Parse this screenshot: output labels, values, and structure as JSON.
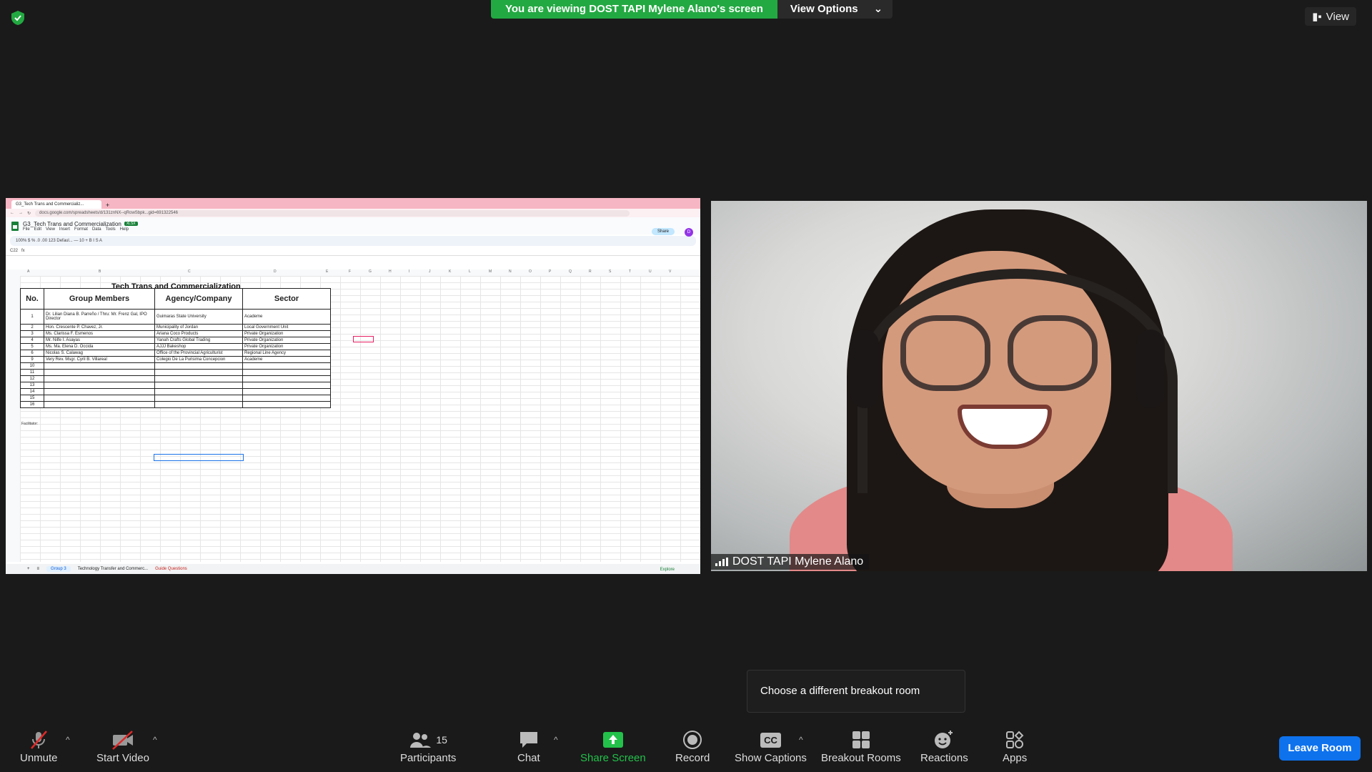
{
  "banner": {
    "viewing_text": "You are viewing DOST TAPI Mylene Alano's screen",
    "view_options": "View Options"
  },
  "top_right": {
    "view_label": "View"
  },
  "shared_screen": {
    "browser_tab": "G3_Tech Trans and Commercializ...",
    "url": "docs.google.com/spreadsheets/d/131znNX--qRowSbpk...gid=691322546",
    "doc_title": "G3_Tech Trans and Commercialization",
    "doc_badge": "XLSX",
    "menu": [
      "File",
      "Edit",
      "View",
      "Insert",
      "Format",
      "Data",
      "Tools",
      "Help"
    ],
    "share_label": "Share",
    "avatar_letter": "D",
    "toolbar_text": "100%  $  %  .0  .00  123  Defaul...  —  10  +  B  I  S  A",
    "name_box": "C22",
    "sheet_title": "Tech Trans and Commercialization",
    "columns": [
      "A",
      "B",
      "C",
      "D",
      "E",
      "F",
      "G",
      "H",
      "I",
      "J",
      "K",
      "L",
      "M",
      "N",
      "O",
      "P",
      "Q",
      "R",
      "S",
      "T",
      "U",
      "V"
    ],
    "table_headers": [
      "No.",
      "Group Members",
      "Agency/Company",
      "Sector"
    ],
    "rows": [
      [
        "1",
        "Dr. Lilian Diana B. Parreño / Thru: Mr. Frenz Gal, IPO Director",
        "Guimaras State University",
        "Academe"
      ],
      [
        "2",
        "Hon. Crescente P. Chavez, Jr.",
        "Municipality of Jordan",
        "Local Government Unit"
      ],
      [
        "3",
        "Ms. Clarissa F. Esmenos",
        "Ariana Coco Products",
        "Private Organization"
      ],
      [
        "4",
        "Mr. Nilfe I. Asayas",
        "Yanah Crafts Global Trading",
        "Private Organization"
      ],
      [
        "5",
        "Ms. Ma. Elena D. Occida",
        "AJJJ Bakeshop",
        "Private Organization"
      ],
      [
        "6",
        "Nicolas S. Calawag",
        "Office of the Provincial Agriculturist",
        "Regional Line Agency"
      ],
      [
        "9",
        "Very Rev. Msgr. Cyril B. Villareal",
        "Colegio De La Purisima Concepcion",
        "Academe"
      ],
      [
        "10",
        "",
        "",
        ""
      ],
      [
        "11",
        "",
        "",
        ""
      ],
      [
        "12",
        "",
        "",
        ""
      ],
      [
        "13",
        "",
        "",
        ""
      ],
      [
        "14",
        "",
        "",
        ""
      ],
      [
        "15",
        "",
        "",
        ""
      ],
      [
        "16",
        "",
        "",
        ""
      ]
    ],
    "facilitator_label": "Facilitator:",
    "sheet_tabs": [
      "Group 3",
      "Technology Transfer and Commerc...",
      "Guide Questions"
    ],
    "explore_label": "Explore"
  },
  "video": {
    "participant_name": "DOST TAPI Mylene Alano"
  },
  "tooltip": {
    "text": "Choose a different breakout room"
  },
  "toolbar": {
    "unmute": "Unmute",
    "start_video": "Start Video",
    "participants": "Participants",
    "participants_count": "15",
    "chat": "Chat",
    "share_screen": "Share Screen",
    "record": "Record",
    "captions": "Show Captions",
    "captions_icon": "CC",
    "breakout": "Breakout Rooms",
    "reactions": "Reactions",
    "apps": "Apps",
    "leave": "Leave Room"
  },
  "colors": {
    "green": "#23a942",
    "leave_blue": "#0e72ed",
    "share_green": "#23c14a"
  }
}
